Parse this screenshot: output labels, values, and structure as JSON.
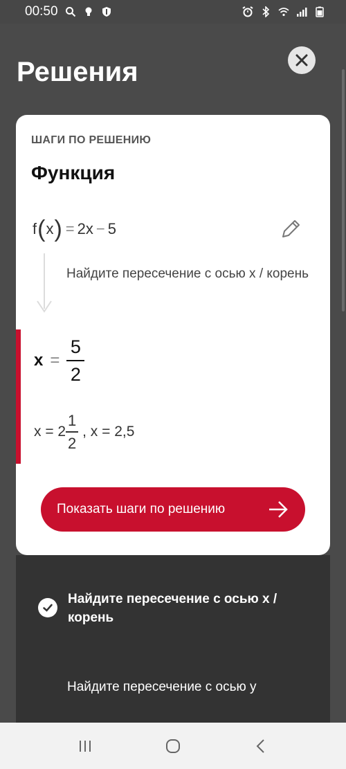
{
  "status_bar": {
    "time": "00:50"
  },
  "header": {
    "title": "Решения"
  },
  "card": {
    "steps_heading": "ШАГИ ПО РЕШЕНИЮ",
    "func_title": "Функция",
    "expression": {
      "f": "f",
      "x": "x",
      "eq": "=",
      "lhs": "2x",
      "op": "−",
      "rhs": "5"
    },
    "step_text": "Найдите пересечение с осью x / корень",
    "result": {
      "var": "x",
      "eq": "=",
      "num": "5",
      "den": "2"
    },
    "result_alt": {
      "lead": "x = 2",
      "num": "1",
      "den": "2",
      "tail": ", x = 2,5"
    },
    "show_steps_label": "Показать шаги по решению"
  },
  "list": {
    "item_1": "Найдите пересечение с осью x / корень",
    "item_2": "Найдите пересечение с осью y"
  },
  "colors": {
    "accent": "#c8102e",
    "background": "#4a4a4a",
    "panel": "#333333"
  }
}
